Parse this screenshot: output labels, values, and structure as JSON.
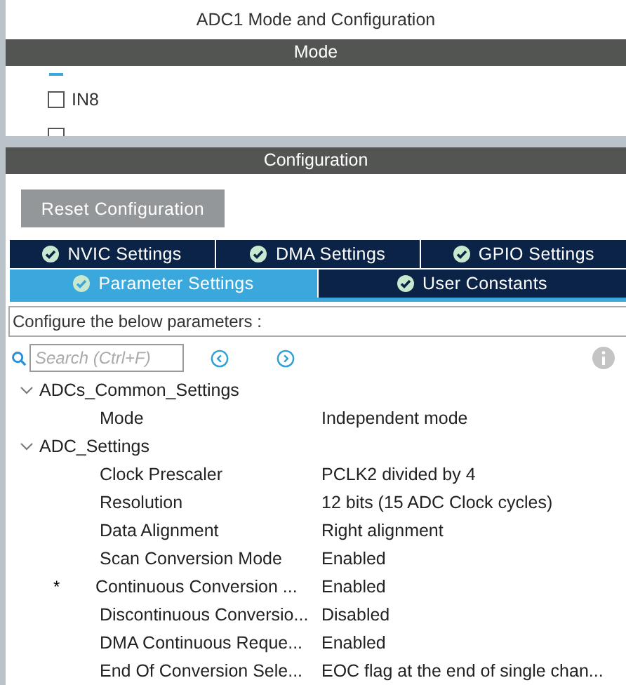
{
  "window": {
    "title": "ADC1 Mode and Configuration"
  },
  "mode": {
    "header": "Mode",
    "items": [
      {
        "kind": "checkbox",
        "label": "IN8",
        "checked": false
      },
      {
        "kind": "checkbox",
        "checked": false
      }
    ]
  },
  "configuration": {
    "header": "Configuration",
    "reset_button": "Reset Configuration",
    "tab_rows": [
      [
        {
          "label": "NVIC Settings",
          "selected": false
        },
        {
          "label": "DMA Settings",
          "selected": false
        },
        {
          "label": "GPIO Settings",
          "selected": false
        }
      ],
      [
        {
          "label": "Parameter Settings",
          "selected": true
        },
        {
          "label": "User Constants",
          "selected": false
        }
      ]
    ],
    "description": "Configure the below parameters :",
    "search": {
      "placeholder": "Search (Ctrl+F)"
    },
    "groups": [
      {
        "name": "ADCs_Common_Settings",
        "expanded": true,
        "children": [
          {
            "name": "Mode",
            "value": "Independent mode"
          }
        ]
      },
      {
        "name": "ADC_Settings",
        "expanded": true,
        "children": [
          {
            "name": "Clock Prescaler",
            "value": "PCLK2 divided by 4"
          },
          {
            "name": "Resolution",
            "value": "12 bits (15 ADC Clock cycles)"
          },
          {
            "name": "Data Alignment",
            "value": "Right alignment"
          },
          {
            "name": "Scan Conversion Mode",
            "value": "Enabled"
          },
          {
            "name": "Continuous Conversion ...",
            "value": "Enabled",
            "marker": "*"
          },
          {
            "name": "Discontinuous Conversio...",
            "value": "Disabled"
          },
          {
            "name": "DMA Continuous Reque...",
            "value": "Enabled"
          },
          {
            "name": "End Of Conversion Sele...",
            "value": "EOC flag at the end of single chan..."
          }
        ]
      }
    ]
  }
}
